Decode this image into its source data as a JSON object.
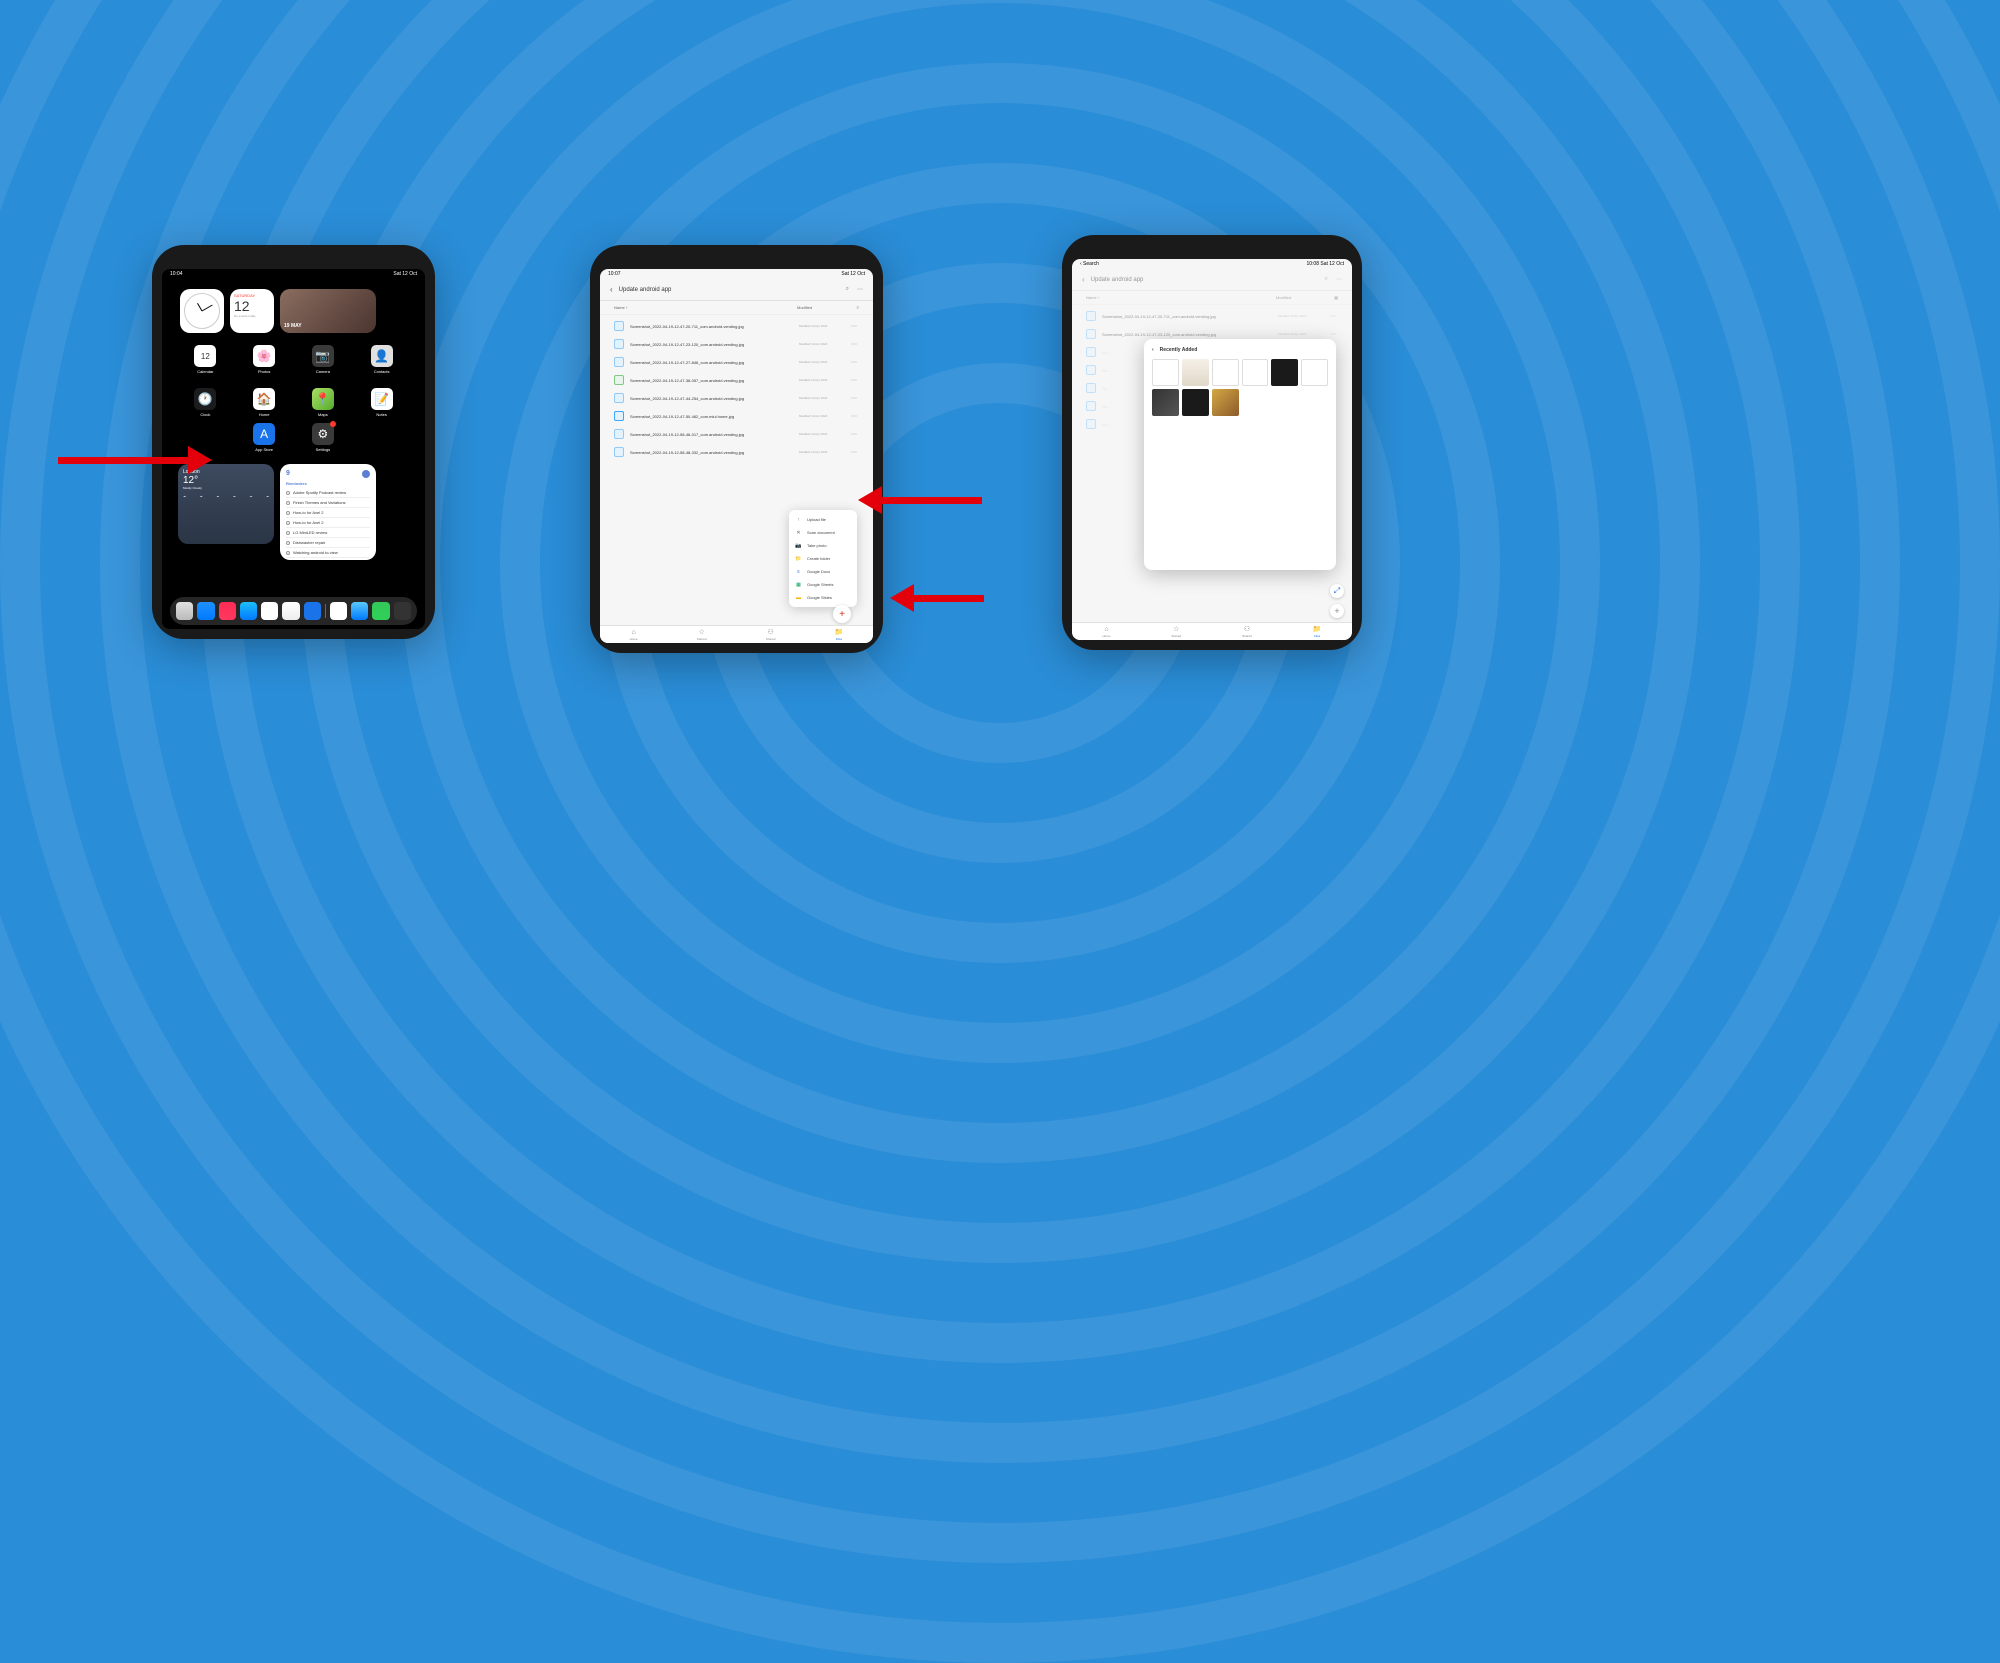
{
  "colors": {
    "background": "#2a8dd7",
    "arrow": "#e3000b",
    "accent_blue": "#1a73e8"
  },
  "tablet1": {
    "status_time": "10:04",
    "status_date": "Sat 12 Oct",
    "calendar_day": "12",
    "photo_label": "19 MAY",
    "apps_row1": [
      {
        "label": "Calendar",
        "bg": "#fff"
      },
      {
        "label": "Photos",
        "bg": "#fff"
      },
      {
        "label": "Camera",
        "bg": "#3a3a3a"
      },
      {
        "label": "Contacts",
        "bg": "#e0e0e0"
      }
    ],
    "apps_row2": [
      {
        "label": "Clock",
        "bg": "#1c1c1e"
      },
      {
        "label": "Home",
        "bg": "#fff"
      },
      {
        "label": "Maps",
        "bg": "#e8f5e9"
      },
      {
        "label": "Notes",
        "bg": "#fff"
      }
    ],
    "apps_row3": [
      {
        "label": "App Store",
        "bg": "#1a73e8"
      },
      {
        "label": "Settings",
        "bg": "#3a3a3a"
      }
    ],
    "weather": {
      "city": "London",
      "temp": "12°",
      "cond": "Mostly Cloudy"
    },
    "reminders": {
      "count": "9",
      "title": "Reminders",
      "items": [
        "Adobe Spotify Podcast review",
        "Finish Themes and Variations",
        "How-to for Axel 2",
        "How-to for Axel 2",
        "LG MiniLED review",
        "Dishwasher repair",
        "Watching android to-view"
      ]
    }
  },
  "tablet2": {
    "status_time": "10:07",
    "status_date": "Sat 12 Oct",
    "breadcrumb": "Update android app",
    "col_name": "Name ↑",
    "col_mod": "Modified",
    "files": [
      {
        "name": "Screenshot_2022-04-19-12-47-20-711_com.android.vending.jpg",
        "mod": "Modified 19 Apr 2022",
        "icon": "img"
      },
      {
        "name": "Screenshot_2022-04-19-12-47-23-120_com.android.vending.jpg",
        "mod": "Modified 19 Apr 2022",
        "icon": "img"
      },
      {
        "name": "Screenshot_2022-04-19-12-47-27-846_com.android.vending.jpg",
        "mod": "Modified 19 Apr 2022",
        "icon": "img"
      },
      {
        "name": "Screenshot_2022-04-19-12-47-38-057_com.android.vending.jpg",
        "mod": "Modified 19 Apr 2022",
        "icon": "g"
      },
      {
        "name": "Screenshot_2022-04-19-12-47-44-254_com.android.vending.jpg",
        "mod": "Modified 19 Apr 2022",
        "icon": "img"
      },
      {
        "name": "Screenshot_2022-04-19-12-47-50-462_com.miui.home.jpg",
        "mod": "Modified 19 Apr 2022",
        "icon": "b"
      },
      {
        "name": "Screenshot_2022-04-19-12-58-46-017_com.android.vending.jpg",
        "mod": "Modified 19 Apr 2022",
        "icon": "img"
      },
      {
        "name": "Screenshot_2022-04-19-12-58-48-332_com.android.vending.jpg",
        "mod": "Modified 19 Apr 2022",
        "icon": "img"
      }
    ],
    "fab_items": [
      {
        "icon": "↑",
        "label": "Upload file",
        "color": "#5f6368"
      },
      {
        "icon": "✕",
        "label": "Scan document",
        "color": "#5f6368"
      },
      {
        "icon": "📷",
        "label": "Take photo",
        "color": "#5f6368"
      },
      {
        "icon": "📁",
        "label": "Create folder",
        "color": "#5f6368"
      },
      {
        "icon": "≡",
        "label": "Google Docs",
        "color": "#4285f4"
      },
      {
        "icon": "▦",
        "label": "Google Sheets",
        "color": "#0f9d58"
      },
      {
        "icon": "▬",
        "label": "Google Slides",
        "color": "#f4b400"
      }
    ],
    "tabs": [
      {
        "icon": "⌂",
        "label": "Home"
      },
      {
        "icon": "☆",
        "label": "Starred"
      },
      {
        "icon": "⚇",
        "label": "Shared"
      },
      {
        "icon": "📁",
        "label": "Files"
      }
    ]
  },
  "tablet3": {
    "status_back": "‹ Search",
    "status_time": "10:08",
    "status_date": "Sat 12 Oct",
    "breadcrumb": "Update android app",
    "col_name": "Name ↑",
    "col_mod": "Modified",
    "files_bg": [
      {
        "name": "Screenshot_2022-04-19-12-47-20-711_com.android.vending.jpg",
        "mod": "Modified 19 Apr 2022"
      },
      {
        "name": "Screenshot_2022-04-19-12-47-23-120_com.android.vending.jpg",
        "mod": "Modified 19 Apr 2022"
      }
    ],
    "picker_title": "Recently Added",
    "tabs": [
      {
        "icon": "⌂",
        "label": "Home"
      },
      {
        "icon": "☆",
        "label": "Starred"
      },
      {
        "icon": "⚇",
        "label": "Shared"
      },
      {
        "icon": "📁",
        "label": "Files"
      }
    ]
  }
}
